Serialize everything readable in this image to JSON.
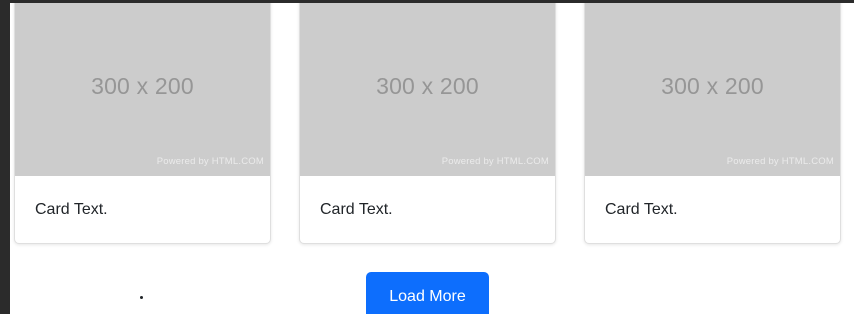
{
  "cards": [
    {
      "image_dimensions": "300 x 200",
      "image_watermark": "Powered by HTML.COM",
      "text": "Card Text."
    },
    {
      "image_dimensions": "300 x 200",
      "image_watermark": "Powered by HTML.COM",
      "text": "Card Text."
    },
    {
      "image_dimensions": "300 x 200",
      "image_watermark": "Powered by HTML.COM",
      "text": "Card Text."
    }
  ],
  "load_more": {
    "label": "Load More"
  },
  "colors": {
    "page_background": "#ffffff",
    "frame": "#2b2b2b",
    "placeholder_bg": "#cccccc",
    "placeholder_text": "#969696",
    "button_bg": "#0d6efd",
    "button_text": "#ffffff",
    "card_text": "#212529"
  }
}
